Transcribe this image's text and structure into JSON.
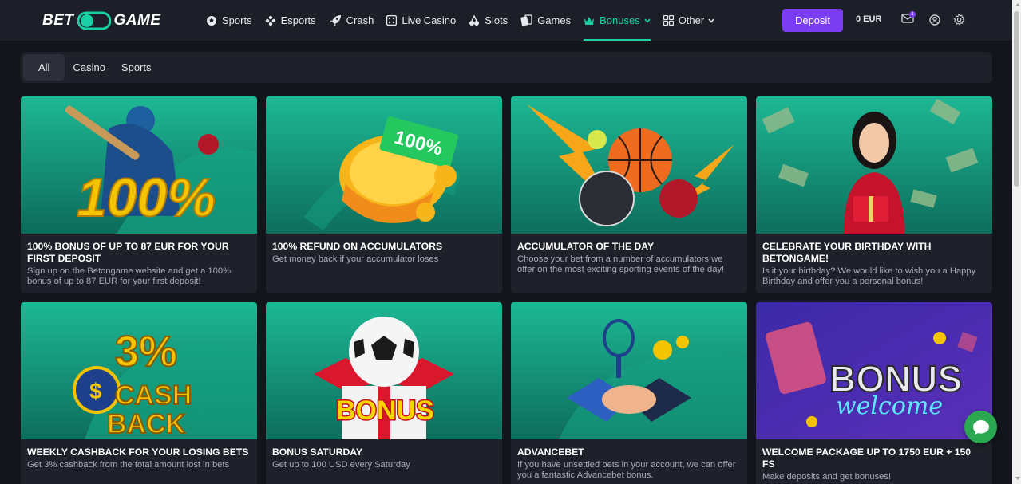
{
  "logo": {
    "part1": "BET",
    "part2": "ON",
    "part3": "GAME"
  },
  "nav": [
    {
      "label": "Sports",
      "icon": "soccer-ball-icon"
    },
    {
      "label": "Esports",
      "icon": "esports-icon"
    },
    {
      "label": "Crash",
      "icon": "rocket-icon"
    },
    {
      "label": "Live Casino",
      "icon": "live-casino-icon"
    },
    {
      "label": "Slots",
      "icon": "slots-icon"
    },
    {
      "label": "Games",
      "icon": "cards-icon"
    },
    {
      "label": "Bonuses",
      "icon": "crown-icon",
      "active": true
    },
    {
      "label": "Other",
      "icon": "grid-icon"
    }
  ],
  "header": {
    "deposit_label": "Deposit",
    "balance": "0 EUR",
    "notification_count": "1"
  },
  "filters": [
    "All",
    "Casino",
    "Sports"
  ],
  "colors": {
    "accent": "#19d0a4",
    "deposit": "#7b3df2",
    "chat": "#2aa84f"
  },
  "cards": [
    {
      "title": "100% BONUS OF UP TO 87 EUR FOR YOUR FIRST DEPOSIT",
      "desc": "Sign up on the Betongame website and get a 100% bonus of up to 87 EUR for your first deposit!",
      "image": "cricket-100-percent",
      "image_text": "100%"
    },
    {
      "title": "100% REFUND ON ACCUMULATORS",
      "desc": "Get money back if your accumulator loses",
      "image": "refund-coins",
      "image_text": "100%"
    },
    {
      "title": "ACCUMULATOR OF THE DAY",
      "desc": "Choose your bet from a number of accumulators we offer on the most exciting sporting events of the day!",
      "image": "sport-balls-lightning"
    },
    {
      "title": "CELEBRATE YOUR BIRTHDAY WITH BETONGAME!",
      "desc": "Is it your birthday? We would like to wish you a Happy Birthday and offer you a personal bonus!",
      "image": "woman-gift-money"
    },
    {
      "title": "WEEKLY CASHBACK FOR YOUR LOSING BETS",
      "desc": "Get 3% cashback from the total amount lost in bets",
      "image": "cashback-3-percent",
      "image_text": [
        "3%",
        "CASH",
        "BACK"
      ]
    },
    {
      "title": "BONUS SATURDAY",
      "desc": "Get up to 100 USD every Saturday",
      "image": "soccer-gift-box",
      "image_text": "BONUS"
    },
    {
      "title": "ADVANCEBET",
      "desc": "If you have unsettled bets in your account, we can offer you a fantastic Advancebet bonus.",
      "image": "handshake"
    },
    {
      "title": "WELCOME PACKAGE UP TO 1750 EUR + 150 FS",
      "desc": "Make deposits and get bonuses!",
      "image": "bonus-welcome-neon",
      "image_text": [
        "BONUS",
        "welcome"
      ]
    }
  ]
}
